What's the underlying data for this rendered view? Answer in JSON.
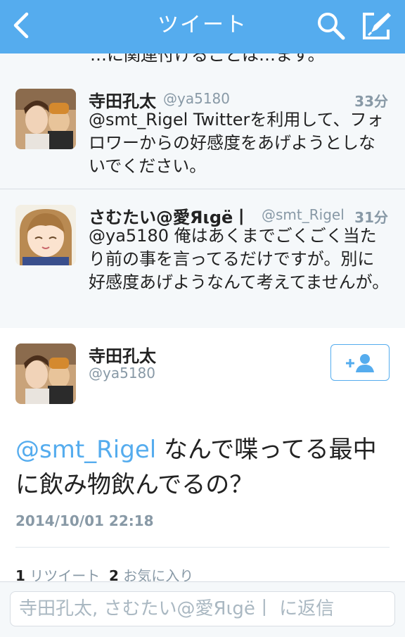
{
  "nav": {
    "title": "ツイート",
    "back_icon": "chevron-left-icon",
    "search_icon": "search-icon",
    "compose_icon": "compose-icon",
    "bg_color": "#55acee"
  },
  "cut_tweet": {
    "text": "…に関連付けることは…ます。"
  },
  "tweets": [
    {
      "name": "寺田孔太",
      "handle": "@ya5180",
      "time": "33分",
      "text": "@smt_Rigel Twitterを利用して、フォロワーからの好感度をあげようとしないでください。"
    },
    {
      "name": "さむたい@愛Яιgё丨",
      "handle": "@smt_Rigel",
      "time": "31分",
      "text": "@ya5180 俺はあくまでごくごく当たり前の事を言ってるだけですが。別に好感度あげようなんて考えてませんが。"
    }
  ],
  "detail": {
    "name": "寺田孔太",
    "handle": "@ya5180",
    "follow_icon": "add-user-icon",
    "mention": "@smt_Rigel",
    "text": " なんで喋ってる最中に飲み物飲んでるの？",
    "date": "2014/10/01 22:18",
    "retweet_count": "1",
    "retweet_label": "リツイート",
    "favorite_count": "2",
    "favorite_label": "お気に入り"
  },
  "reply": {
    "placeholder": "寺田孔太, さむたい@愛Яιgё丨 に返信"
  },
  "colors": {
    "accent": "#55acee",
    "muted": "#8899a6",
    "text": "#222222"
  }
}
